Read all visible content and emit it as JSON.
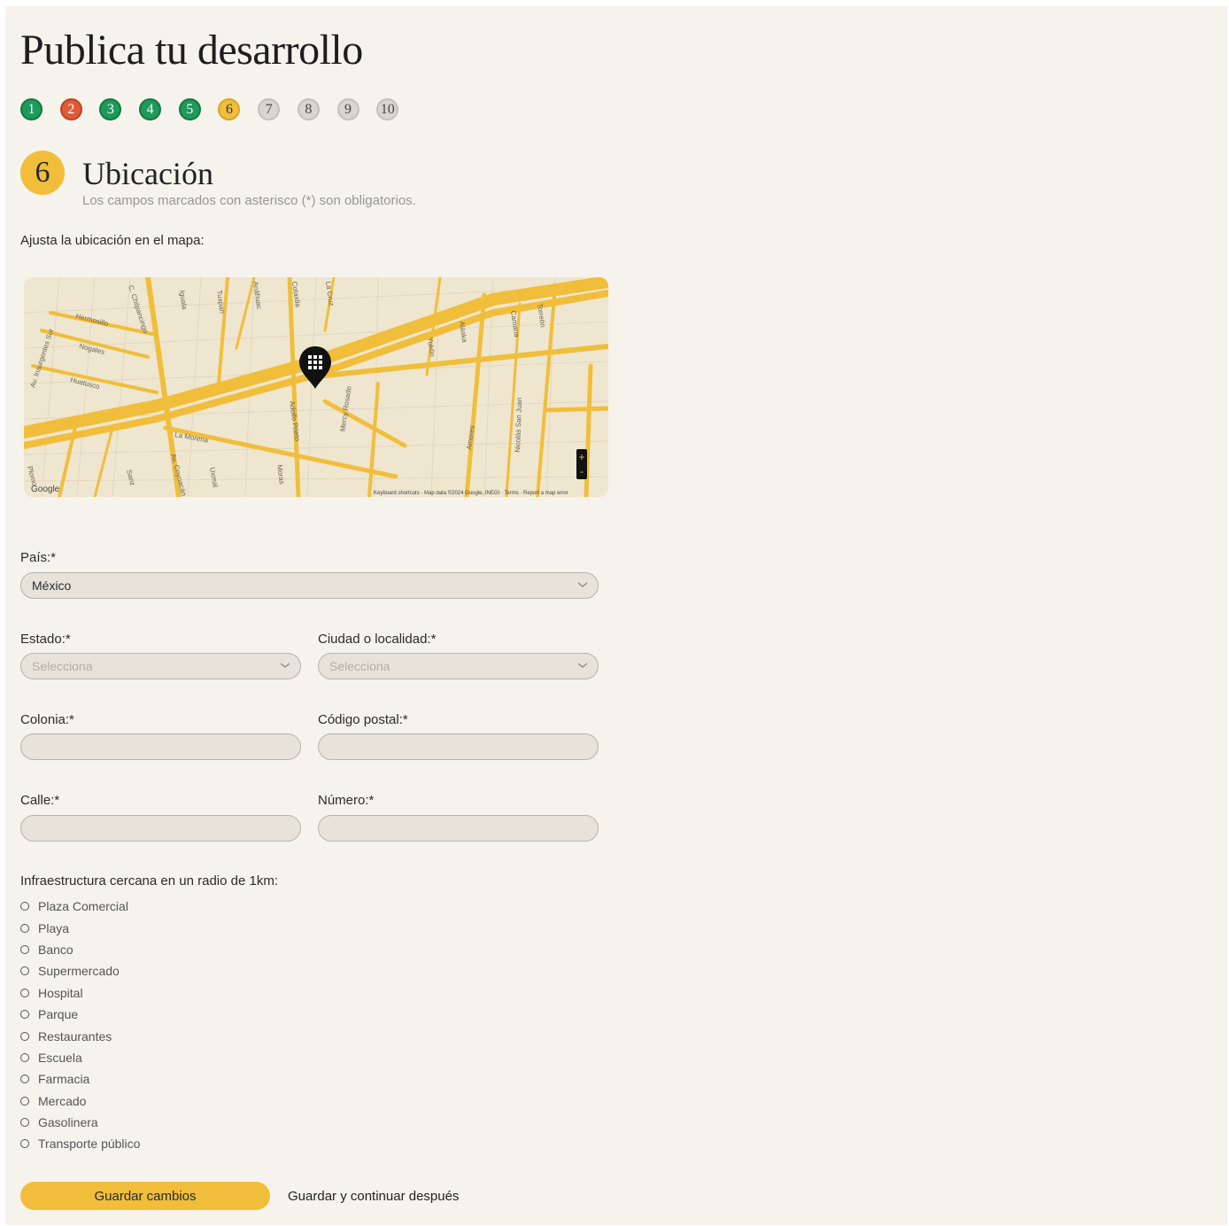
{
  "page_title": "Publica tu desarrollo",
  "steps": [
    "1",
    "2",
    "3",
    "4",
    "5",
    "6",
    "7",
    "8",
    "9",
    "10"
  ],
  "step_states": [
    "done",
    "error",
    "done",
    "done",
    "done",
    "current",
    "pending",
    "pending",
    "pending",
    "pending"
  ],
  "section": {
    "number": "6",
    "title": "Ubicación",
    "note": "Los campos marcados con asterisco (*) son obligatorios."
  },
  "map": {
    "label": "Ajusta la ubicación en el mapa:",
    "attribution": "Google",
    "footer": "Keyboard shortcuts · Map data ©2024 Google, INEGI · Terms · Report a map error",
    "streets": [
      "Hermosillo",
      "Nogales",
      "Huatusco",
      "Av. Insurgentes Sur",
      "C. Chilpancingo",
      "Iguala",
      "Tuxpan",
      "Anáhuac",
      "Cotaxtla",
      "La Cruz",
      "Yukón",
      "Alaska",
      "Camana",
      "Torreón",
      "La Morena",
      "Adolfo Prieto",
      "Moras",
      "Mercy Rosado",
      "Amores",
      "Nicolás San Juan",
      "Av. Coyoacán",
      "Uxmal",
      "Sanz",
      "Plomo"
    ],
    "zoom_in": "+",
    "zoom_out": "-",
    "colors": {
      "roads": "#f0be3b",
      "base": "#efe6cf",
      "pin": "#111111"
    }
  },
  "form": {
    "pais_label": "País:*",
    "pais_value": "México",
    "estado_label": "Estado:*",
    "estado_placeholder": "Selecciona",
    "ciudad_label": "Ciudad o localidad:*",
    "ciudad_placeholder": "Selecciona",
    "colonia_label": "Colonia:*",
    "cp_label": "Código postal:*",
    "calle_label": "Calle:*",
    "numero_label": "Número:*"
  },
  "infra": {
    "label": "Infraestructura cercana en un radio de 1km:",
    "options": [
      "Plaza Comercial",
      "Playa",
      "Banco",
      "Supermercado",
      "Hospital",
      "Parque",
      "Restaurantes",
      "Escuela",
      "Farmacia",
      "Mercado",
      "Gasolinera",
      "Transporte público"
    ]
  },
  "buttons": {
    "save": "Guardar cambios",
    "later": "Guardar y continuar después"
  },
  "colors": {
    "accent": "#f0be3b",
    "done": "#1e9a5b",
    "error": "#e05a36",
    "pending": "#d8d6d0",
    "background": "#f5f3ec"
  }
}
